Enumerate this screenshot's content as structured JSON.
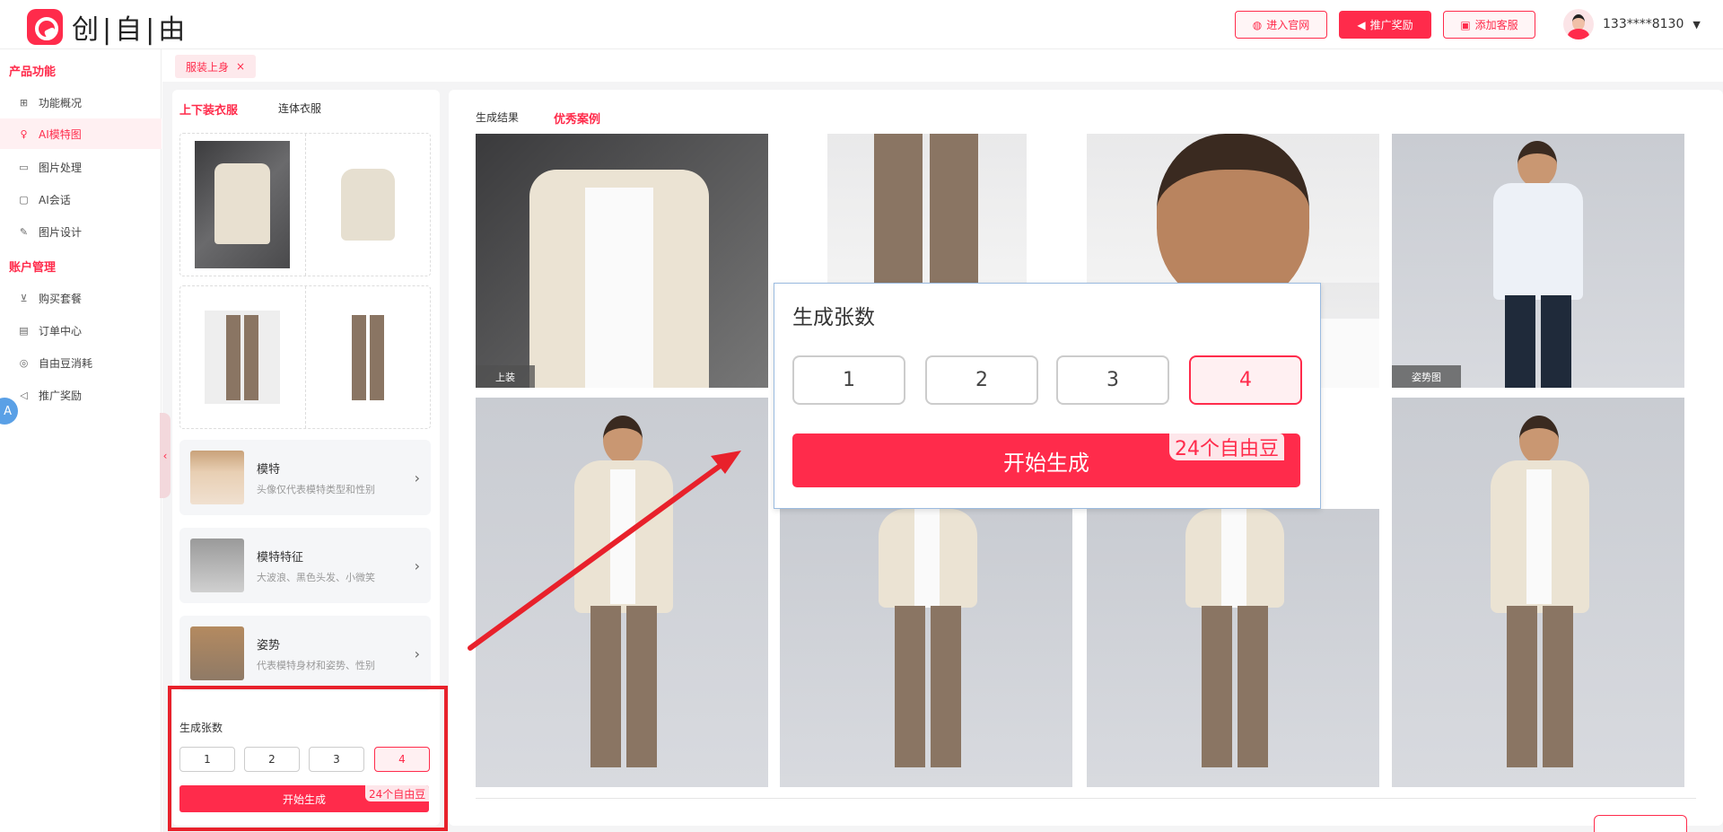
{
  "header": {
    "logo_text": "创|自|由",
    "buttons": [
      {
        "label": "进入官网",
        "icon": "globe-icon"
      },
      {
        "label": "推广奖励",
        "icon": "megaphone-icon"
      },
      {
        "label": "添加客服",
        "icon": "gift-icon"
      }
    ],
    "user": "133****8130"
  },
  "sidebar": {
    "group1": "产品功能",
    "group2": "账户管理",
    "items1": [
      "功能概况",
      "AI模特图",
      "图片处理",
      "AI会话",
      "图片设计"
    ],
    "items2": [
      "购买套餐",
      "订单中心",
      "自由豆消耗",
      "推广奖励"
    ],
    "active": "AI模特图",
    "float_label": "A"
  },
  "tabbar": {
    "tab_label": "服装上身",
    "close": "×"
  },
  "left": {
    "tabs": [
      "上下装衣服",
      "连体衣服"
    ],
    "options": [
      {
        "title": "模特",
        "subtitle": "头像仅代表模特类型和性别"
      },
      {
        "title": "模特特征",
        "subtitle": "大波浪、黑色头发、小微笑"
      },
      {
        "title": "姿势",
        "subtitle": "代表模特身材和姿势、性别"
      }
    ],
    "count_label": "生成张数",
    "counts": [
      "1",
      "2",
      "3",
      "4"
    ],
    "selected_count": "4",
    "start_label": "开始生成",
    "cost": "24个自由豆"
  },
  "right": {
    "tabs": [
      "生成结果",
      "优秀案例"
    ],
    "active_tab": "优秀案例",
    "photo_labels": {
      "top": "上装",
      "pose": "姿势图"
    }
  },
  "zoom": {
    "title": "生成张数",
    "counts": [
      "1",
      "2",
      "3",
      "4"
    ],
    "selected": "4",
    "start_label": "开始生成",
    "cost": "24个自由豆"
  },
  "colors": {
    "accent": "#ff2b4b",
    "annotation_red": "#e8212b"
  }
}
